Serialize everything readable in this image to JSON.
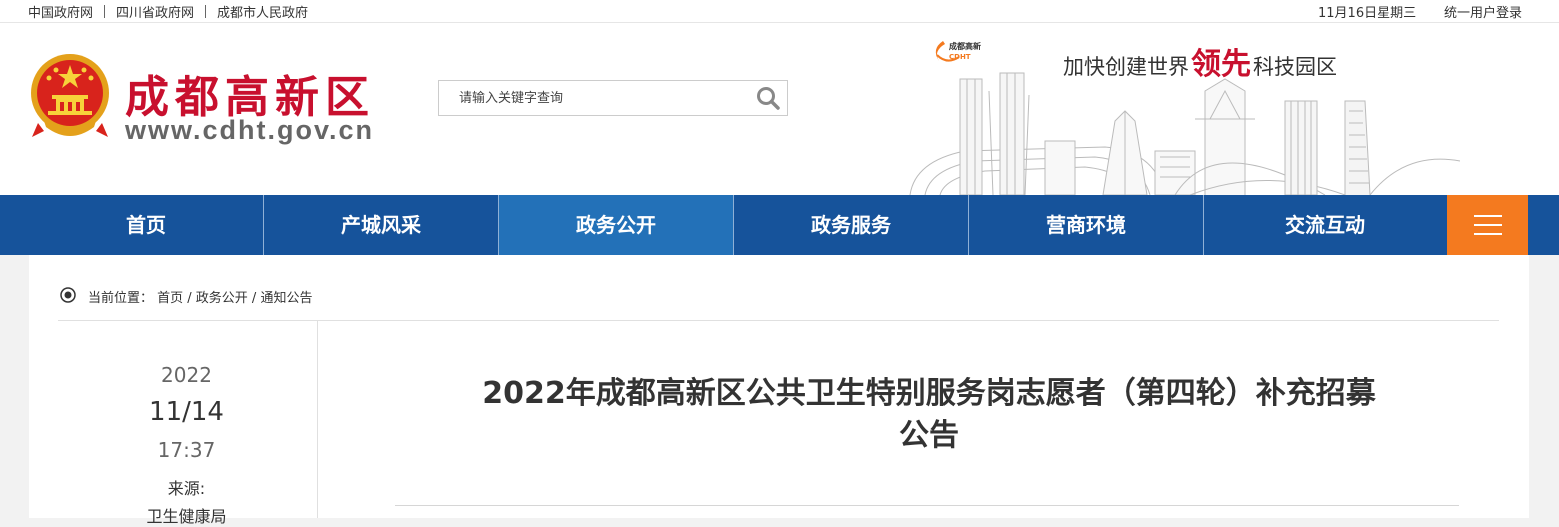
{
  "topbar": {
    "links": [
      "中国政府网",
      "四川省政府网",
      "成都市人民政府"
    ],
    "date": "11月16日星期三",
    "login": "统一用户登录"
  },
  "header": {
    "site_name": "成都高新区",
    "site_url": "www.cdht.gov.cn",
    "search_placeholder": "请输入关键字查询",
    "logo_text": "成都高新",
    "logo_sub": "CDHT",
    "slogan_before": "加快创建世界",
    "slogan_accent": "领先",
    "slogan_after": "科技园区",
    "brand_red": "#c8102e"
  },
  "nav": {
    "items": [
      "首页",
      "产城风采",
      "政务公开",
      "政务服务",
      "营商环境",
      "交流互动"
    ],
    "active_index": 2,
    "color": "#16539b",
    "active_color": "#2371b8",
    "menu_color": "#f47a1f",
    "menu_icon": "hamburger-icon"
  },
  "breadcrumb": {
    "label": "当前位置：",
    "path": "首页 / 政务公开 / 通知公告"
  },
  "article": {
    "year": "2022",
    "month_day": "11/14",
    "time": "17:37",
    "source_label": "来源:",
    "source": "卫生健康局",
    "title_line1": "2022年成都高新区公共卫生特别服务岗志愿者（第四轮）补充招募",
    "title_line2": "公告"
  }
}
